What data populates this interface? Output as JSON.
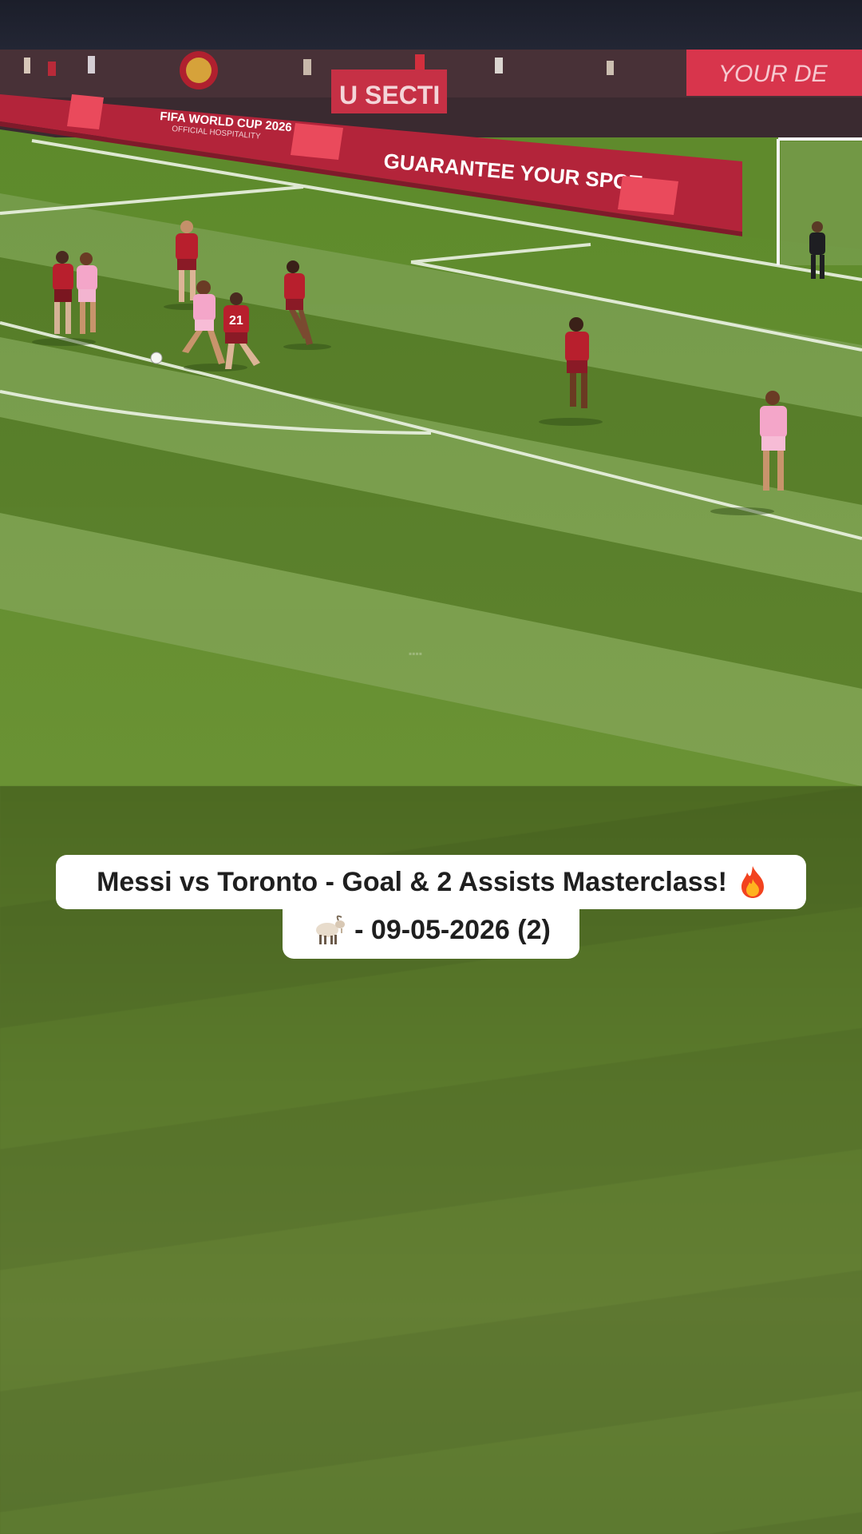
{
  "video": {
    "ad_board_slogan": "GUARANTEE YOUR SPOT",
    "ad_board_event": "FIFA WORLD CUP 2026",
    "ad_board_event_sub": "OFFICIAL HOSPITALITY",
    "banner_text": "U SECTI",
    "banner_right": "YOUR DE",
    "player_number": "21"
  },
  "caption": {
    "line1": "Messi vs Toronto - Goal & 2 Assists Masterclass!",
    "line1_emoji": "fire-icon",
    "line2_emoji": "goat-icon",
    "line2": "- 09-05-2026 (2)"
  },
  "colors": {
    "pitch": "#5f8a2c",
    "board": "#b3243a",
    "caption_bg": "#ffffff",
    "home_kit": "#b81f2d",
    "away_kit": "#f4a6c9"
  }
}
